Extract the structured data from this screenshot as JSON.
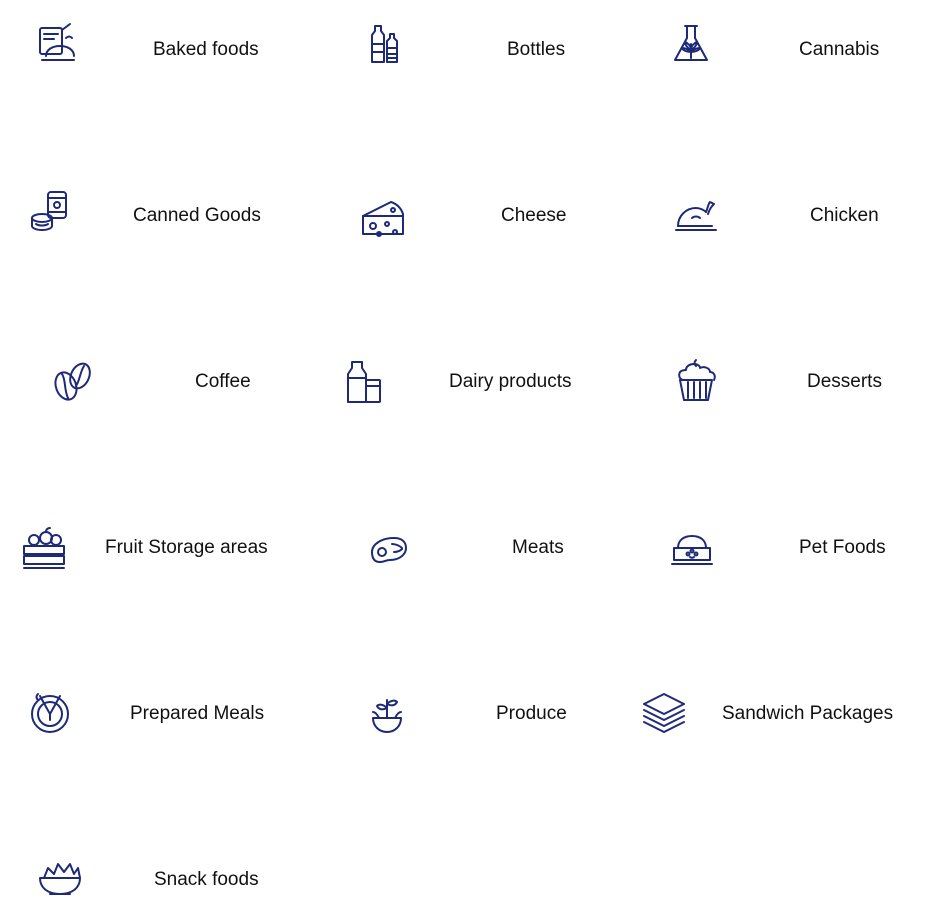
{
  "categories": [
    {
      "label": "Baked foods",
      "icon": "baked-foods-icon"
    },
    {
      "label": "Bottles",
      "icon": "bottles-icon"
    },
    {
      "label": "Cannabis",
      "icon": "cannabis-icon"
    },
    {
      "label": "Canned Goods",
      "icon": "canned-goods-icon"
    },
    {
      "label": "Cheese",
      "icon": "cheese-icon"
    },
    {
      "label": "Chicken",
      "icon": "chicken-icon"
    },
    {
      "label": "Coffee",
      "icon": "coffee-icon"
    },
    {
      "label": "Dairy products",
      "icon": "dairy-products-icon"
    },
    {
      "label": "Desserts",
      "icon": "desserts-icon"
    },
    {
      "label": "Fruit Storage areas",
      "icon": "fruit-storage-icon"
    },
    {
      "label": "Meats",
      "icon": "meats-icon"
    },
    {
      "label": "Pet Foods",
      "icon": "pet-foods-icon"
    },
    {
      "label": "Prepared Meals",
      "icon": "prepared-meals-icon"
    },
    {
      "label": "Produce",
      "icon": "produce-icon"
    },
    {
      "label": "Sandwich Packages",
      "icon": "sandwich-packages-icon"
    },
    {
      "label": "Snack foods",
      "icon": "snack-foods-icon"
    }
  ],
  "colors": {
    "icon_stroke": "#1e2a78",
    "text": "#111111",
    "background": "#ffffff"
  }
}
